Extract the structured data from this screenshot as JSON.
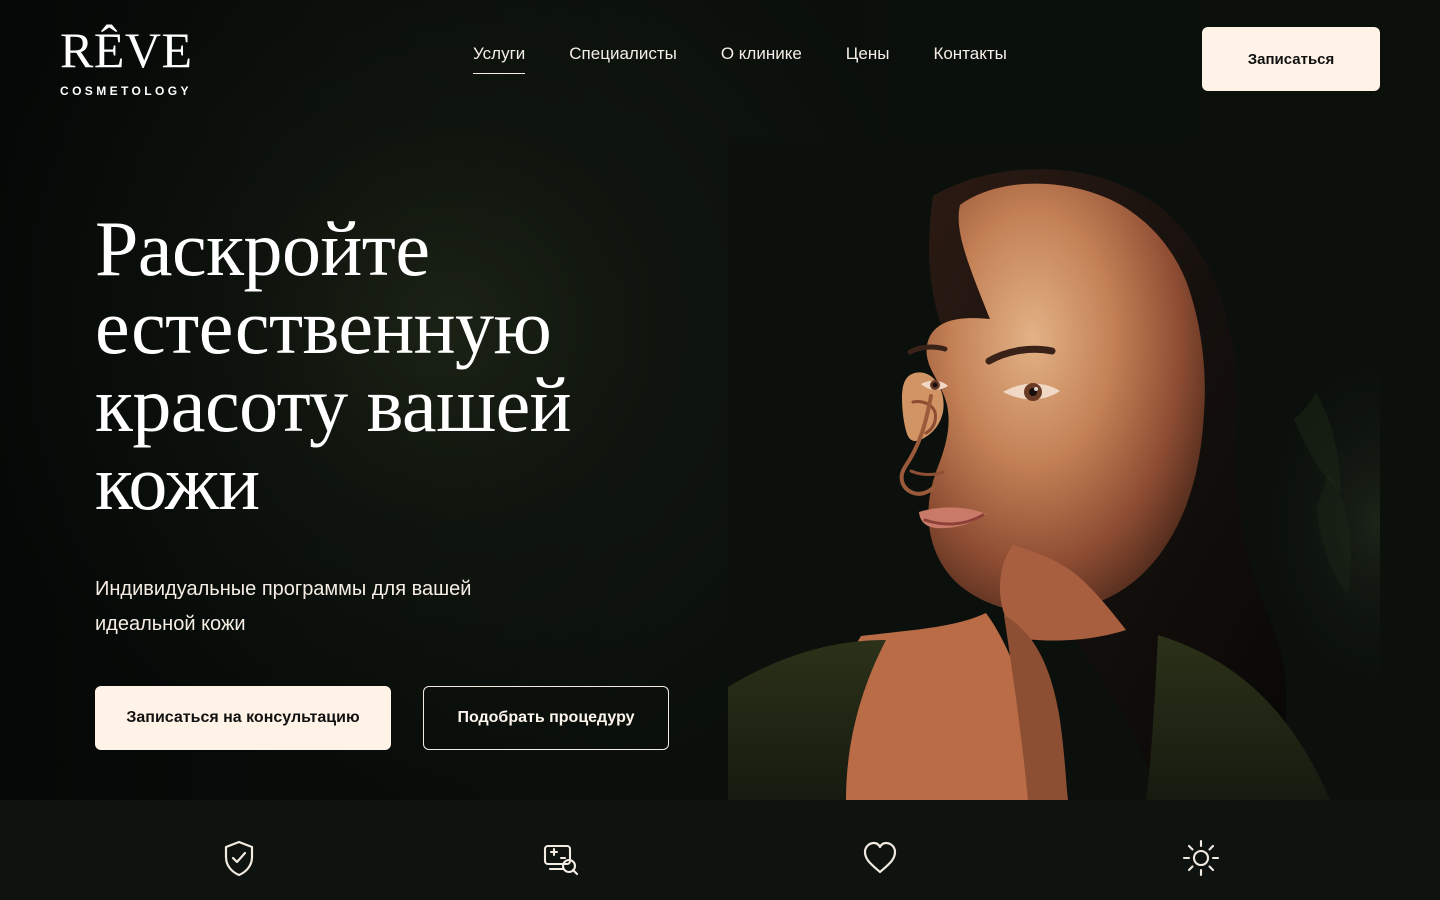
{
  "header": {
    "brand": {
      "name": "RÊVE",
      "tagline": "COSMETOLOGY"
    },
    "nav": [
      {
        "label": "Услуги",
        "active": true
      },
      {
        "label": "Специалисты",
        "active": false
      },
      {
        "label": "О клинике",
        "active": false
      },
      {
        "label": "Цены",
        "active": false
      },
      {
        "label": "Контакты",
        "active": false
      }
    ],
    "cta_label": "Записаться"
  },
  "hero": {
    "title_lines": [
      "Раскройте",
      "естественную",
      "красоту вашей",
      "кожи"
    ],
    "subtitle_lines": [
      "Индивидуальные программы для вашей",
      "идеальной кожи"
    ],
    "primary_button": "Записаться на консультацию",
    "secondary_button": "Подобрать процедуру"
  },
  "features": [
    {
      "icon": "shield-check-icon"
    },
    {
      "icon": "skin-analysis-icon"
    },
    {
      "icon": "heart-icon"
    },
    {
      "icon": "sun-icon"
    }
  ],
  "colors": {
    "background": "#070b08",
    "button_fill": "#fff2e6",
    "text": "#f4eee6"
  }
}
